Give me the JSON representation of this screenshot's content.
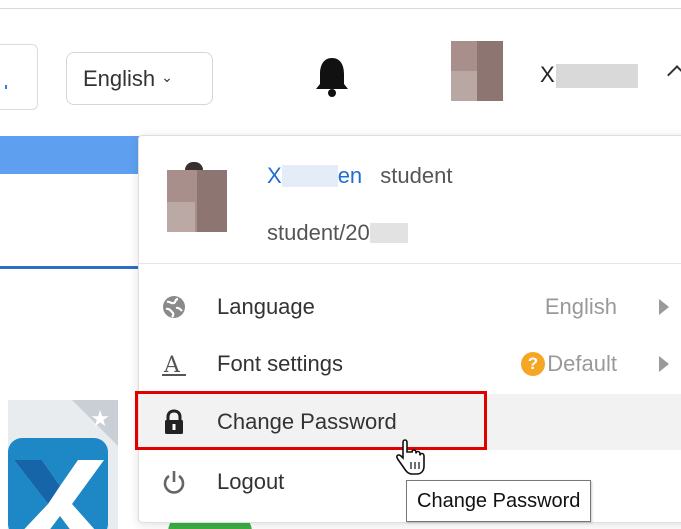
{
  "header": {
    "language_select": {
      "value": "English"
    },
    "user": {
      "name_initial": "X"
    }
  },
  "menu": {
    "profile": {
      "name_first": "X",
      "name_last": "en",
      "role": "student",
      "id_prefix": "student/20"
    },
    "items": [
      {
        "label": "Language",
        "value": "English",
        "icon": "globe-icon"
      },
      {
        "label": "Font settings",
        "value": "Default",
        "icon": "font-a-icon",
        "badge": "?"
      },
      {
        "label": "Change Password",
        "icon": "lock-icon"
      },
      {
        "label": "Logout",
        "icon": "power-icon"
      }
    ]
  },
  "tooltip": {
    "text": "Change Password"
  },
  "colors": {
    "link_blue": "#1f6fd1",
    "highlight_red": "#e00000",
    "badge_orange": "#f5a623",
    "band_blue": "#5ea0ef"
  }
}
